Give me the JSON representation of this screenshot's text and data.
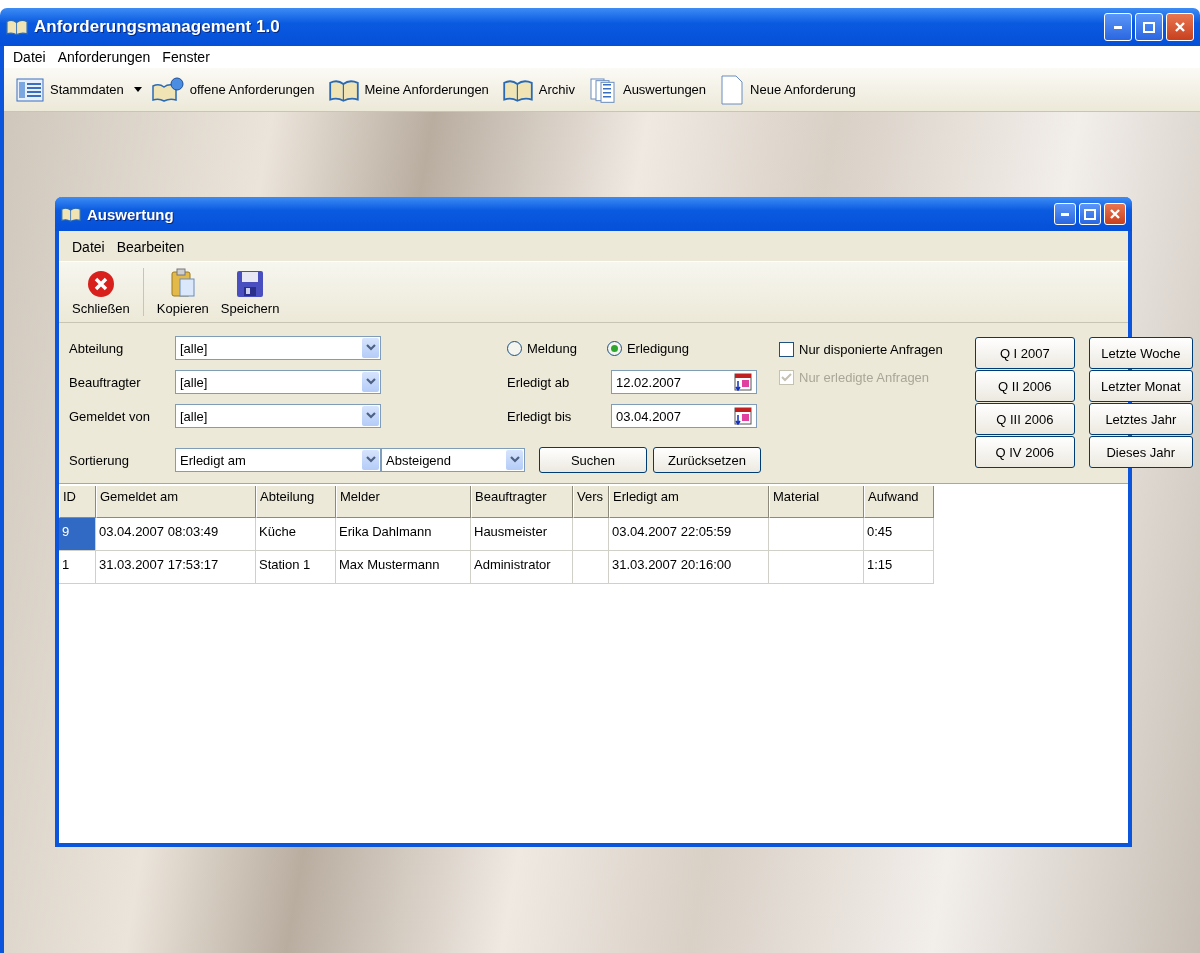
{
  "window": {
    "title": "Anforderungsmanagement 1.0"
  },
  "menu": [
    "Datei",
    "Anforderungen",
    "Fenster"
  ],
  "toolbar": [
    {
      "label": "Stammdaten",
      "kind": "list",
      "dropdown": true
    },
    {
      "label": "offene Anforderungen",
      "kind": "book-globe",
      "dropdown": false
    },
    {
      "label": "Meine Anforderungen",
      "kind": "book",
      "dropdown": false
    },
    {
      "label": "Archiv",
      "kind": "book",
      "dropdown": false
    },
    {
      "label": "Auswertungen",
      "kind": "docs",
      "dropdown": false
    },
    {
      "label": "Neue Anforderung",
      "kind": "page",
      "dropdown": false
    }
  ],
  "child_window": {
    "title": "Auswertung",
    "menu": [
      "Datei",
      "Bearbeiten"
    ],
    "toolbar": [
      {
        "label": "Schließen",
        "kind": "close"
      },
      {
        "label": "Kopieren",
        "kind": "paste"
      },
      {
        "label": "Speichern",
        "kind": "save"
      }
    ],
    "filters": [
      {
        "label": "Abteilung",
        "value": "[alle]"
      },
      {
        "label": "Beauftragter",
        "value": "[alle]"
      },
      {
        "label": "Gemeldet von",
        "value": "[alle]"
      }
    ],
    "date_mode": [
      {
        "label": "Meldung",
        "selected": false
      },
      {
        "label": "Erledigung",
        "selected": true
      }
    ],
    "dates": [
      {
        "label": "Erledigt ab",
        "value": "12.02.2007"
      },
      {
        "label": "Erledigt bis",
        "value": "03.04.2007"
      }
    ],
    "checkboxes": [
      {
        "label": "Nur disponierte Anfragen",
        "checked": false,
        "disabled": false
      },
      {
        "label": "Nur erledigte Anfragen",
        "checked": true,
        "disabled": true
      }
    ],
    "sort": {
      "label": "Sortierung",
      "field": "Erledigt am",
      "order": "Absteigend"
    },
    "actions": [
      "Suchen",
      "Zurücksetzen"
    ],
    "quarter_buttons": [
      "Q I 2007",
      "Q II 2006",
      "Q III 2006",
      "Q IV 2006"
    ],
    "period_buttons": [
      "Letzte Woche",
      "Letzter Monat",
      "Letztes Jahr",
      "Dieses Jahr"
    ],
    "table": {
      "columns": [
        "ID",
        "Gemeldet am",
        "Abteilung",
        "Melder",
        "Beauftragter",
        "Vers",
        "Erledigt am",
        "Material",
        "Aufwand"
      ],
      "rows": [
        {
          "selected": true,
          "cells": [
            "9",
            "03.04.2007 08:03:49",
            "Küche",
            "Erika Dahlmann",
            "Hausmeister",
            "",
            "03.04.2007 22:05:59",
            "",
            "0:45"
          ]
        },
        {
          "selected": false,
          "cells": [
            "1",
            "31.03.2007 17:53:17",
            "Station 1",
            "Max Mustermann",
            "Administrator",
            "",
            "31.03.2007 20:16:00",
            "",
            "1:15"
          ]
        }
      ]
    }
  }
}
